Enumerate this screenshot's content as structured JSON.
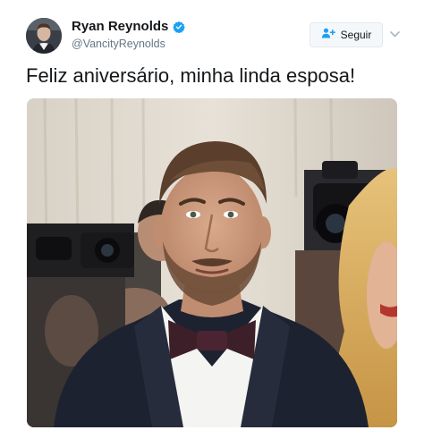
{
  "user": {
    "display_name": "Ryan Reynolds",
    "handle": "@VancityReynolds",
    "verified": true,
    "avatar_icon": "profile-photo"
  },
  "follow_button": {
    "label": "Seguir",
    "icon": "add-user-icon"
  },
  "caret_icon": "chevron-down-icon",
  "tweet": {
    "text": "Feliz aniversário, minha linda esposa!"
  },
  "media": {
    "type": "photo"
  },
  "colors": {
    "verified_blue": "#1da1f2",
    "text_primary": "#14171a",
    "text_secondary": "#657786",
    "button_bg": "#f5f8fa",
    "button_border": "#e1e8ed"
  }
}
